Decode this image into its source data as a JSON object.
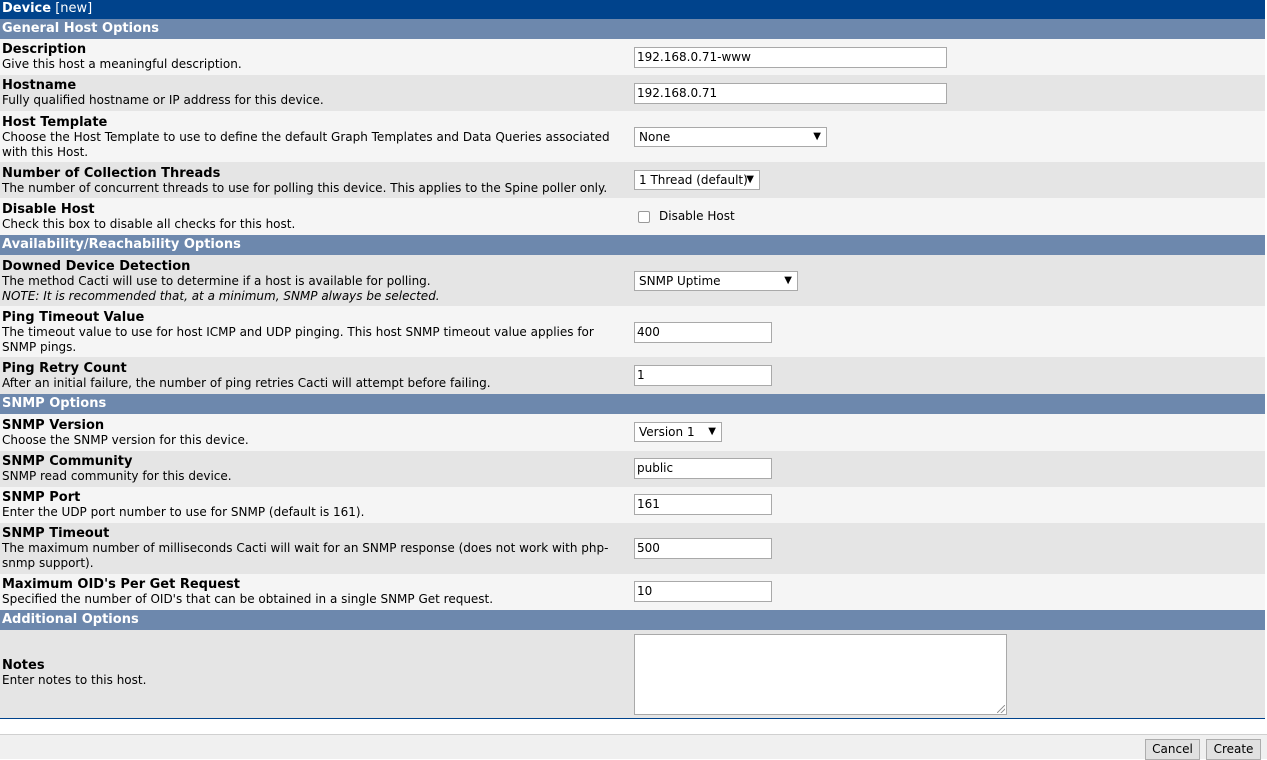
{
  "title": {
    "main": "Device",
    "suffix": "[new]"
  },
  "sections": {
    "general": "General Host Options",
    "availability": "Availability/Reachability Options",
    "snmp": "SNMP Options",
    "additional": "Additional Options"
  },
  "fields": {
    "description": {
      "label": "Description",
      "help": "Give this host a meaningful description.",
      "value": "192.168.0.71-www"
    },
    "hostname": {
      "label": "Hostname",
      "help": "Fully qualified hostname or IP address for this device.",
      "value": "192.168.0.71"
    },
    "host_template": {
      "label": "Host Template",
      "help": "Choose the Host Template to use to define the default Graph Templates and Data Queries associated with this Host.",
      "value": "None"
    },
    "threads": {
      "label": "Number of Collection Threads",
      "help": "The number of concurrent threads to use for polling this device. This applies to the Spine poller only.",
      "value": "1 Thread (default)"
    },
    "disable_host": {
      "label": "Disable Host",
      "help": "Check this box to disable all checks for this host.",
      "checkbox_label": "Disable Host",
      "checked": false
    },
    "downed_detection": {
      "label": "Downed Device Detection",
      "help": "The method Cacti will use to determine if a host is available for polling.",
      "note": "NOTE: It is recommended that, at a minimum, SNMP always be selected.",
      "value": "SNMP Uptime"
    },
    "ping_timeout": {
      "label": "Ping Timeout Value",
      "help": "The timeout value to use for host ICMP and UDP pinging. This host SNMP timeout value applies for SNMP pings.",
      "value": "400"
    },
    "ping_retry": {
      "label": "Ping Retry Count",
      "help": "After an initial failure, the number of ping retries Cacti will attempt before failing.",
      "value": "1"
    },
    "snmp_version": {
      "label": "SNMP Version",
      "help": "Choose the SNMP version for this device.",
      "value": "Version 1"
    },
    "snmp_community": {
      "label": "SNMP Community",
      "help": "SNMP read community for this device.",
      "value": "public"
    },
    "snmp_port": {
      "label": "SNMP Port",
      "help": "Enter the UDP port number to use for SNMP (default is 161).",
      "value": "161"
    },
    "snmp_timeout": {
      "label": "SNMP Timeout",
      "help": "The maximum number of milliseconds Cacti will wait for an SNMP response (does not work with php-snmp support).",
      "value": "500"
    },
    "max_oids": {
      "label": "Maximum OID's Per Get Request",
      "help": "Specified the number of OID's that can be obtained in a single SNMP Get request.",
      "value": "10"
    },
    "notes": {
      "label": "Notes",
      "help": "Enter notes to this host.",
      "value": ""
    }
  },
  "buttons": {
    "cancel": "Cancel",
    "create": "Create"
  },
  "colors": {
    "title_bg": "#00438c",
    "section_bg": "#6d88ad",
    "row_light": "#f5f5f5",
    "row_dark": "#e5e5e5"
  },
  "icons": {
    "select_arrow": "dropdown-arrow-icon",
    "checkbox": "checkbox-icon",
    "resize": "resize-grip-icon"
  }
}
